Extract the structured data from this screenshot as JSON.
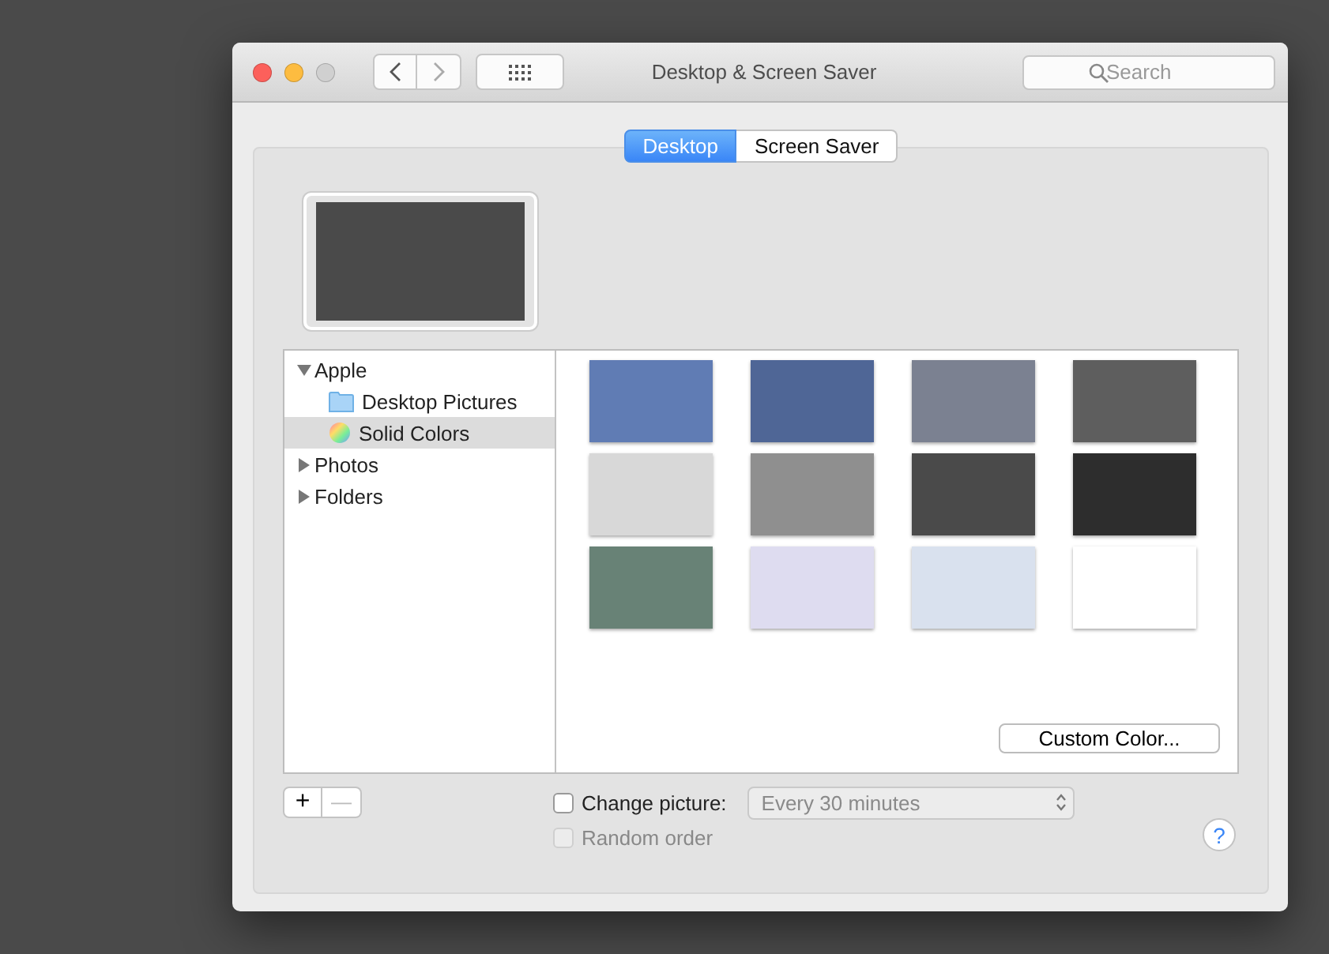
{
  "window": {
    "title": "Desktop & Screen Saver"
  },
  "search": {
    "placeholder": "Search"
  },
  "tabs": [
    {
      "label": "Desktop",
      "selected": true
    },
    {
      "label": "Screen Saver",
      "selected": false
    }
  ],
  "preview": {
    "color": "#4a4a4a"
  },
  "sources": [
    {
      "label": "Apple",
      "expanded": true,
      "selected": false,
      "children": [
        {
          "label": "Desktop Pictures",
          "kind": "folder",
          "selected": false
        },
        {
          "label": "Solid Colors",
          "kind": "colors",
          "selected": true
        }
      ]
    },
    {
      "label": "Photos",
      "expanded": false,
      "selected": false
    },
    {
      "label": "Folders",
      "expanded": false,
      "selected": false
    }
  ],
  "swatches": [
    {
      "color": "#607cb4"
    },
    {
      "color": "#4f6696"
    },
    {
      "color": "#7b8191"
    },
    {
      "color": "#5e5e5e"
    },
    {
      "color": "#d8d8d8"
    },
    {
      "color": "#8f8f8f"
    },
    {
      "color": "#4a4a4a"
    },
    {
      "color": "#2d2d2d"
    },
    {
      "color": "#688276"
    },
    {
      "color": "#dedcf0"
    },
    {
      "color": "#d9e1ee"
    },
    {
      "color": "#ffffff"
    }
  ],
  "custom_color_button": "Custom Color...",
  "add_button": "+",
  "remove_button": "—",
  "change_picture": {
    "label": "Change picture:",
    "checked": false
  },
  "interval": {
    "value": "Every 30 minutes",
    "disabled": true
  },
  "random_order": {
    "label": "Random order",
    "checked": false,
    "disabled": true
  },
  "help_button": "?"
}
